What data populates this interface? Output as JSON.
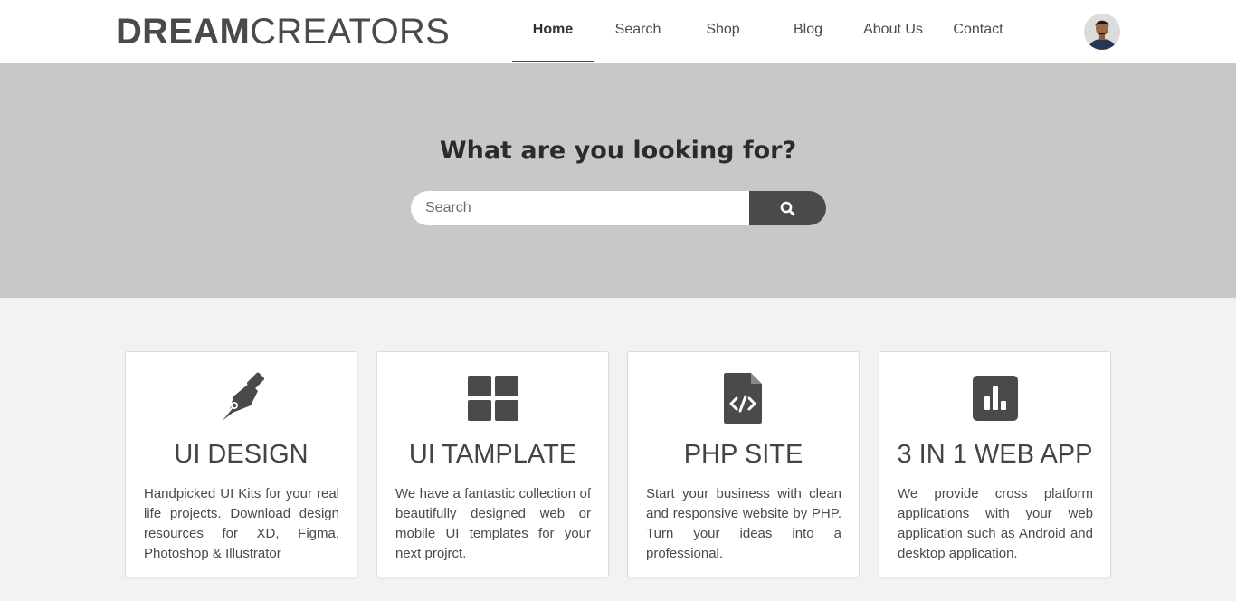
{
  "colors": {
    "header_bg": "#ffffff",
    "hero_bg": "#c8c8c8",
    "page_bg": "#f1f2f4",
    "accent_dark": "#4a4a4a"
  },
  "header": {
    "logo_bold": "DREAM",
    "logo_light": "CREATORS",
    "nav": [
      {
        "label": "Home",
        "active": true
      },
      {
        "label": "Search",
        "active": false
      },
      {
        "label": "Shop",
        "active": false
      },
      {
        "label": "Blog",
        "active": false
      },
      {
        "label": "About Us",
        "active": false
      },
      {
        "label": "Contact",
        "active": false
      }
    ],
    "avatar_icon": "user-avatar"
  },
  "hero": {
    "title": "What are you looking for?",
    "search": {
      "placeholder": "Search",
      "value": "",
      "button_icon": "search-icon"
    }
  },
  "cards": [
    {
      "icon": "pen-nib-icon",
      "title": "UI DESIGN",
      "text": "Handpicked UI Kits for your real life projects. Download design resources for XD, Figma, Photoshop & Illustrator"
    },
    {
      "icon": "grid-icon",
      "title": "UI TAMPLATE",
      "text": "We have a fantastic collection of beautifully designed web or mobile UI templates for your next projrct."
    },
    {
      "icon": "code-file-icon",
      "title": "PHP SITE",
      "text": "Start your business with clean and responsive website by PHP. Turn your ideas into a professional."
    },
    {
      "icon": "bar-chart-icon",
      "title": "3 IN 1 WEB APP",
      "text": "We provide cross platform applications with your web application such as Android and desktop application."
    }
  ]
}
